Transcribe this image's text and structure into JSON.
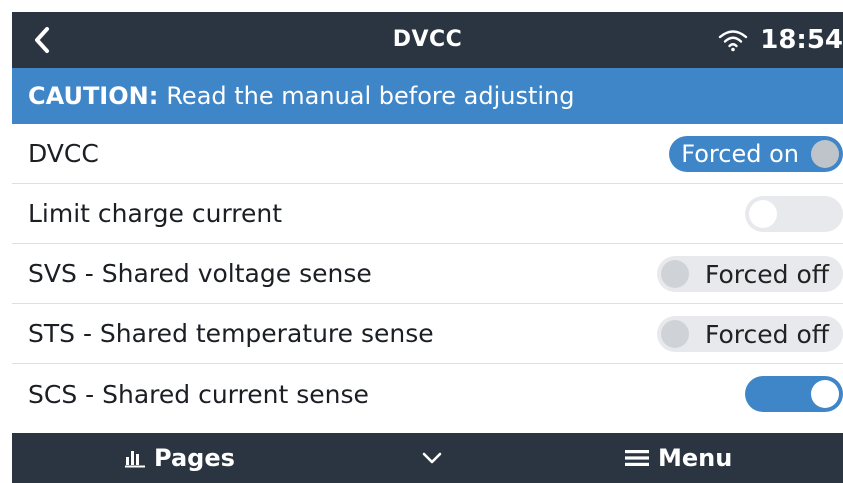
{
  "header": {
    "title": "DVCC",
    "time": "18:54"
  },
  "caution": {
    "label": "CAUTION:",
    "text": "Read the manual before adjusting"
  },
  "settings": [
    {
      "label": "DVCC",
      "state": "Forced on"
    },
    {
      "label": "Limit charge current",
      "state": "off"
    },
    {
      "label": "SVS - Shared voltage sense",
      "state": "Forced off"
    },
    {
      "label": "STS - Shared temperature sense",
      "state": "Forced off"
    },
    {
      "label": "SCS - Shared current sense",
      "state": "on"
    }
  ],
  "footer": {
    "pages_label": "Pages",
    "menu_label": "Menu"
  },
  "colors": {
    "header_bg": "#2b3541",
    "accent": "#3e86c8",
    "switch_off_bg": "#e7e9ec"
  },
  "icons": {
    "back": "chevron-left-icon",
    "wifi": "wifi-icon",
    "pages": "bar-chart-icon",
    "expand": "chevron-down-icon",
    "menu": "hamburger-icon"
  }
}
